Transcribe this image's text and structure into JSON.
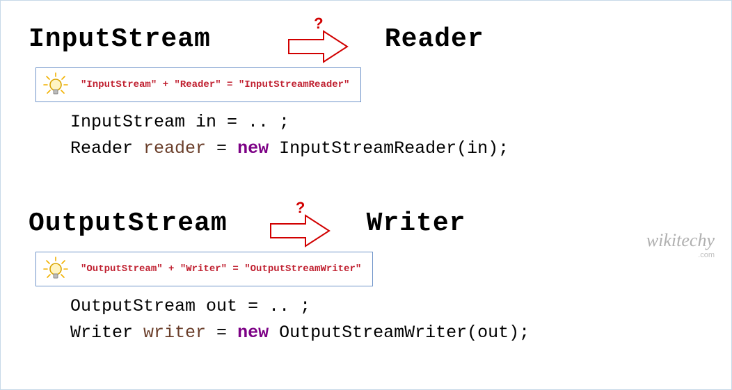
{
  "watermark": {
    "main": "wikitechy",
    "sub": ".com"
  },
  "arrow": {
    "question_mark": "?"
  },
  "sections": [
    {
      "left_title": "InputStream",
      "right_title": "Reader",
      "hint": "\"InputStream\" + \"Reader\" = \"InputStreamReader\"",
      "code_line1_prefix": "InputStream ",
      "code_line1_var": "in",
      "code_line1_rest": " = .. ;",
      "code_line2_prefix": "Reader ",
      "code_line2_var": "reader",
      "code_line2_eq": " = ",
      "code_line2_new": "new",
      "code_line2_call": " InputStreamReader(in);"
    },
    {
      "left_title": "OutputStream",
      "right_title": "Writer",
      "hint": "\"OutputStream\" + \"Writer\" = \"OutputStreamWriter\"",
      "code_line1_prefix": "OutputStream ",
      "code_line1_var": "out",
      "code_line1_rest": " = .. ;",
      "code_line2_prefix": "Writer ",
      "code_line2_var": "writer",
      "code_line2_eq": " = ",
      "code_line2_new": "new",
      "code_line2_call": " OutputStreamWriter(out);"
    }
  ]
}
